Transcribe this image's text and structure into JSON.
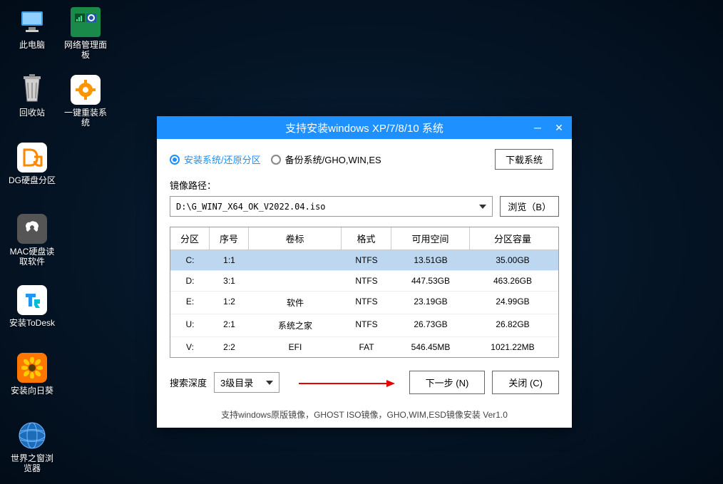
{
  "desktop": {
    "icons": [
      {
        "label": "此电脑",
        "id": "thispc"
      },
      {
        "label": "网络管理面板",
        "id": "netpanel"
      },
      {
        "label": "回收站",
        "id": "recycle"
      },
      {
        "label": "一键重装系统",
        "id": "reinstall"
      },
      {
        "label": "DG硬盘分区",
        "id": "dgpart"
      },
      {
        "label": "MAC硬盘读取软件",
        "id": "macread"
      },
      {
        "label": "安装ToDesk",
        "id": "todesk"
      },
      {
        "label": "安装向日葵",
        "id": "sunflower"
      },
      {
        "label": "世界之窗浏览器",
        "id": "browser"
      }
    ]
  },
  "window": {
    "title": "支持安装windows XP/7/8/10 系统",
    "radio_install": "安装系统/还原分区",
    "radio_backup": "备份系统/GHO,WIN,ES",
    "download_btn": "下载系统",
    "path_label": "镜像路径：",
    "path_value": "D:\\G_WIN7_X64_OK_V2022.04.iso",
    "browse_btn": "浏览（B）",
    "table": {
      "headers": {
        "part": "分区",
        "seq": "序号",
        "vol": "卷标",
        "fmt": "格式",
        "free": "可用空间",
        "size": "分区容量"
      },
      "rows": [
        {
          "part": "C:",
          "seq": "1:1",
          "vol": "",
          "fmt": "NTFS",
          "free": "13.51GB",
          "size": "35.00GB",
          "selected": true
        },
        {
          "part": "D:",
          "seq": "3:1",
          "vol": "",
          "fmt": "NTFS",
          "free": "447.53GB",
          "size": "463.26GB"
        },
        {
          "part": "E:",
          "seq": "1:2",
          "vol": "软件",
          "fmt": "NTFS",
          "free": "23.19GB",
          "size": "24.99GB"
        },
        {
          "part": "U:",
          "seq": "2:1",
          "vol": "系统之家",
          "fmt": "NTFS",
          "free": "26.73GB",
          "size": "26.82GB"
        },
        {
          "part": "V:",
          "seq": "2:2",
          "vol": "EFI",
          "fmt": "FAT",
          "free": "546.45MB",
          "size": "1021.22MB"
        }
      ]
    },
    "depth_label": "搜索深度",
    "depth_value": "3级目录",
    "next_btn": "下一步 (N)",
    "close_btn": "关闭 (C)",
    "footer": "支持windows原版镜像，GHOST ISO镜像，GHO,WIM,ESD镜像安装 Ver1.0"
  }
}
